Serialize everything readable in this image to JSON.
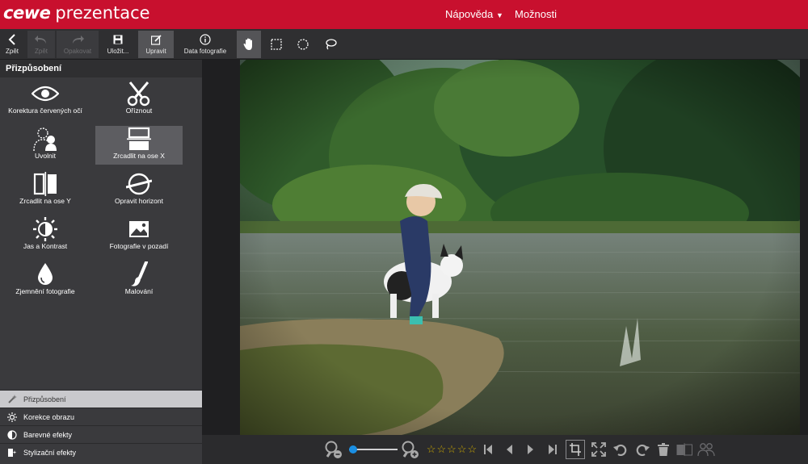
{
  "header": {
    "brand": "cewe",
    "product": "prezentace",
    "menu": {
      "help": "Nápověda",
      "options": "Možnosti"
    }
  },
  "toolbar": {
    "back": "Zpět",
    "undo": "Zpět",
    "redo": "Opakovat",
    "save": "Uložit...",
    "edit": "Upravit",
    "photo_data": "Data fotografie"
  },
  "sidebar": {
    "title": "Přizpůsobení",
    "tools": [
      {
        "label": "Korektura červených očí",
        "icon": "eye-icon"
      },
      {
        "label": "Oříznout",
        "icon": "scissors-icon"
      },
      {
        "label": "Uvolnit",
        "icon": "cutout-person-icon"
      },
      {
        "label": "Zrcadlit na ose X",
        "icon": "mirror-x-icon"
      },
      {
        "label": "Zrcadlit na ose Y",
        "icon": "mirror-y-icon"
      },
      {
        "label": "Opravit horizont",
        "icon": "horizon-icon"
      },
      {
        "label": "Jas a Kontrast",
        "icon": "brightness-contrast-icon"
      },
      {
        "label": "Fotografie v pozadí",
        "icon": "background-photo-icon"
      },
      {
        "label": "Zjemnění fotografie",
        "icon": "drop-icon"
      },
      {
        "label": "Malování",
        "icon": "brush-icon"
      }
    ],
    "selected_tool": "Zrcadlit na ose X",
    "panels": [
      {
        "label": "Přizpůsobení",
        "active": true
      },
      {
        "label": "Korekce obrazu",
        "active": false
      },
      {
        "label": "Barevné efekty",
        "active": false
      },
      {
        "label": "Stylizační efekty",
        "active": false
      }
    ]
  },
  "bottombar": {
    "zoom_level": 0.0,
    "rating": 0,
    "rating_max": 5
  },
  "colors": {
    "brand_red": "#c8102e",
    "accent_blue": "#1a8fe3"
  }
}
